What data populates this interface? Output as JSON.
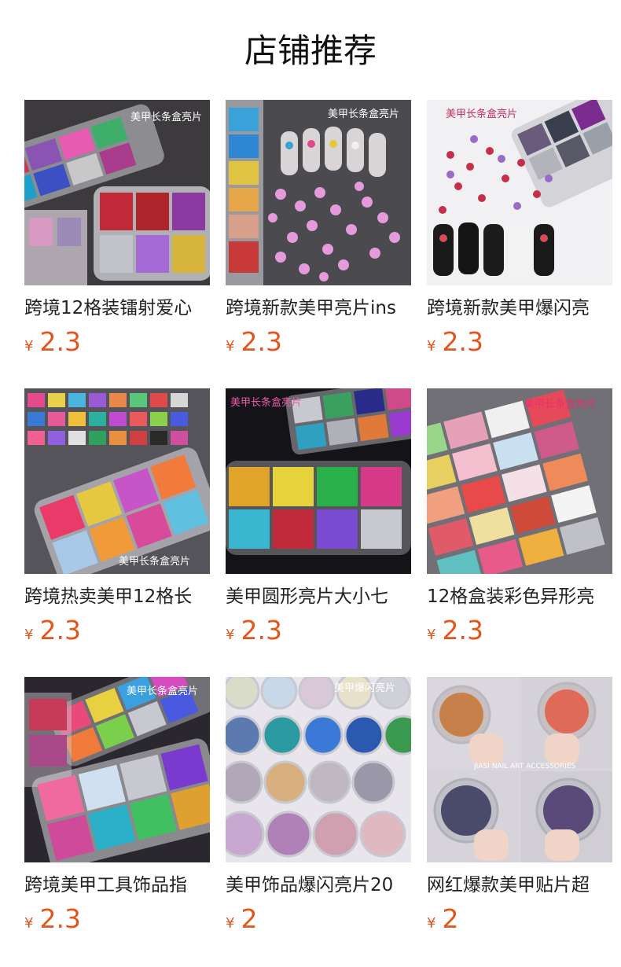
{
  "page": {
    "title": "店铺推荐"
  },
  "colors": {
    "price": "#e4551c",
    "text": "#222222"
  },
  "products": [
    {
      "name": "跨境12格装镭射爱心",
      "currency": "¥",
      "price": "2.3",
      "image_text": "美甲长条盒亮片"
    },
    {
      "name": "跨境新款美甲亮片ins",
      "currency": "¥",
      "price": "2.3",
      "image_text": "美甲长条盒亮片"
    },
    {
      "name": "跨境新款美甲爆闪亮",
      "currency": "¥",
      "price": "2.3",
      "image_text": "美甲长条盒亮片"
    },
    {
      "name": "跨境热卖美甲12格长",
      "currency": "¥",
      "price": "2.3",
      "image_text": "美甲长条盒亮片"
    },
    {
      "name": "美甲圆形亮片大小七",
      "currency": "¥",
      "price": "2.3",
      "image_text": "美甲长条盒亮片"
    },
    {
      "name": "12格盒装彩色异形亮",
      "currency": "¥",
      "price": "2.3",
      "image_text": "美甲长条盒亮片"
    },
    {
      "name": "跨境美甲工具饰品指",
      "currency": "¥",
      "price": "2.3",
      "image_text": "美甲长条盒亮片"
    },
    {
      "name": "美甲饰品爆闪亮片20",
      "currency": "¥",
      "price": "2",
      "image_text": "美甲爆闪亮片"
    },
    {
      "name": "网红爆款美甲贴片超",
      "currency": "¥",
      "price": "2",
      "image_text": "JIASI NAIL ART ACCESSORIES"
    }
  ]
}
